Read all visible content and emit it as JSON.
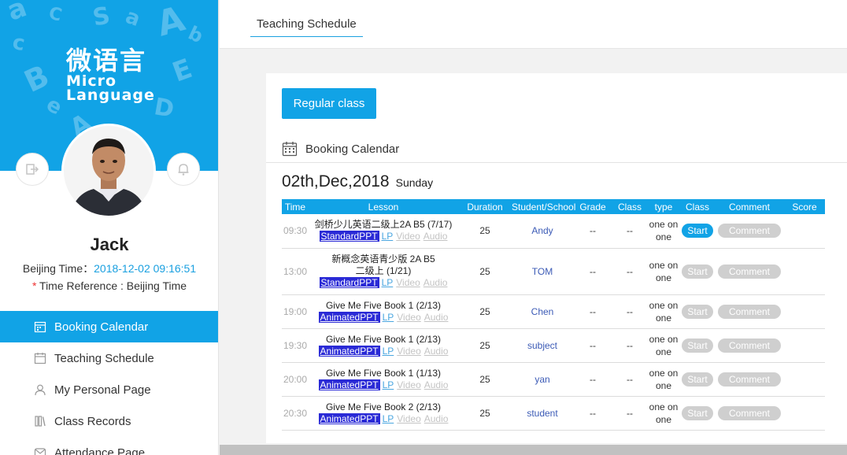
{
  "brand": {
    "name_cn": "微语言",
    "name_en_1": "Micro",
    "name_en_2": "Language"
  },
  "user": {
    "name": "Jack",
    "beijing_time_label": "Beijing Time：",
    "beijing_time_value": "2018-12-02 09:16:51",
    "time_reference_star": "*",
    "time_reference": " Time Reference : Beijing Time"
  },
  "icons": {
    "logout": "logout-icon",
    "bell": "bell-icon"
  },
  "sidebar": {
    "items": [
      {
        "label": "Booking Calendar",
        "icon": "booking-calendar-icon",
        "active": true
      },
      {
        "label": "Teaching Schedule",
        "icon": "calendar-icon",
        "active": false
      },
      {
        "label": "My Personal Page",
        "icon": "user-icon",
        "active": false
      },
      {
        "label": "Class Records",
        "icon": "records-icon",
        "active": false
      },
      {
        "label": "Attendance Page",
        "icon": "attendance-icon",
        "active": false
      }
    ]
  },
  "header": {
    "tab": "Teaching Schedule"
  },
  "main": {
    "regular_button": "Regular class",
    "booking_calendar_title": "Booking Calendar",
    "date": "02th,Dec,2018",
    "weekday": "Sunday"
  },
  "table": {
    "columns": [
      "Time",
      "Lesson",
      "Duration",
      "Student/School",
      "Grade",
      "Class",
      "type",
      "Class",
      "Comment",
      "Score"
    ],
    "start_label": "Start",
    "comment_label": "Comment",
    "lp_label": "LP",
    "video_label": "Video",
    "audio_label": "Audio",
    "rows": [
      {
        "time": "09:30",
        "lesson": "剑桥少儿英语二级上2A B5 (7/17)",
        "ppt": "StandardPPT",
        "duration": "25",
        "student": "Andy",
        "grade": "--",
        "class": "--",
        "type_1": "one on",
        "type_2": "one",
        "start_active": true
      },
      {
        "time": "13:00",
        "lesson": "新概念英语青少版 2A B5二级上 (1/21)",
        "ppt": "StandardPPT",
        "duration": "25",
        "student": "TOM",
        "grade": "--",
        "class": "--",
        "type_1": "one on",
        "type_2": "one",
        "start_active": false
      },
      {
        "time": "19:00",
        "lesson": "Give Me Five Book 1 (2/13)",
        "ppt": "AnimatedPPT",
        "duration": "25",
        "student": "Chen",
        "grade": "--",
        "class": "--",
        "type_1": "one on",
        "type_2": "one",
        "start_active": false
      },
      {
        "time": "19:30",
        "lesson": "Give Me Five Book 1 (2/13)",
        "ppt": "AnimatedPPT",
        "duration": "25",
        "student": "subject",
        "grade": "--",
        "class": "--",
        "type_1": "one on",
        "type_2": "one",
        "start_active": false
      },
      {
        "time": "20:00",
        "lesson": "Give Me Five Book 1 (1/13)",
        "ppt": "AnimatedPPT",
        "duration": "25",
        "student": "yan",
        "grade": "--",
        "class": "--",
        "type_1": "one on",
        "type_2": "one",
        "start_active": false
      },
      {
        "time": "20:30",
        "lesson": "Give Me Five Book 2 (2/13)",
        "ppt": "AnimatedPPT",
        "duration": "25",
        "student": "student",
        "grade": "--",
        "class": "--",
        "type_1": "one on",
        "type_2": "one",
        "start_active": false
      }
    ]
  },
  "colors": {
    "accent": "#11a3e6",
    "ppt_bg": "#2a2ad6",
    "disabled": "#cfcfcf"
  }
}
